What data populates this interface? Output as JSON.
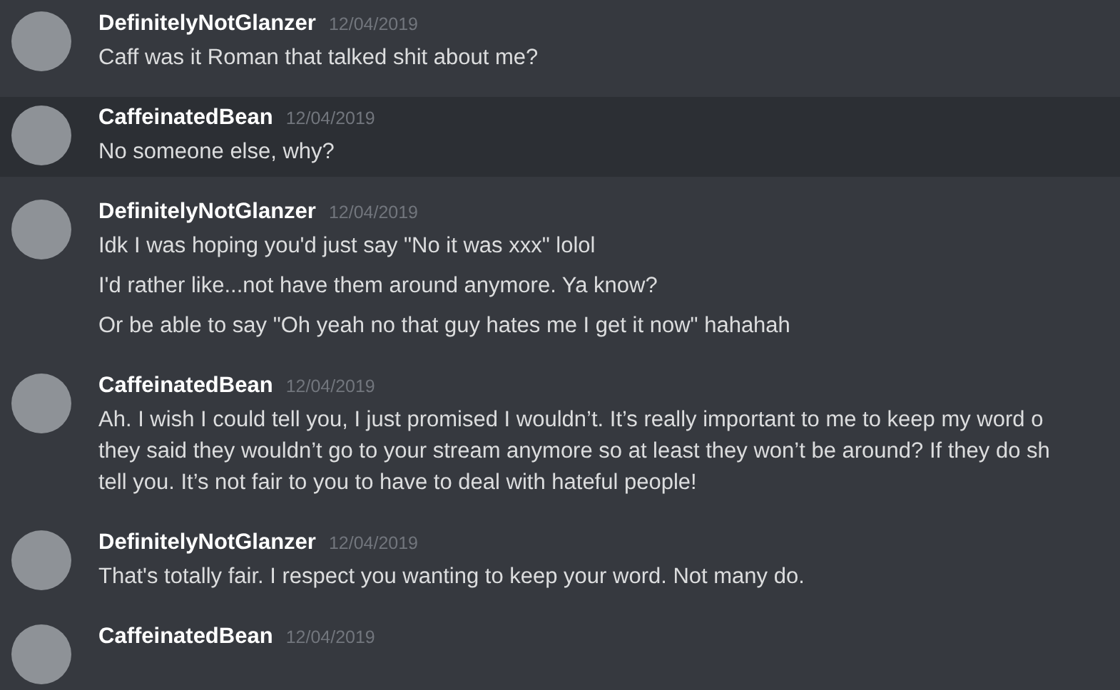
{
  "groups": [
    {
      "author": "DefinitelyNotGlanzer",
      "timestamp": "12/04/2019",
      "messages": [
        {
          "lines": [
            "Caff was it Roman that talked shit about me?"
          ]
        }
      ]
    },
    {
      "author": "CaffeinatedBean",
      "timestamp": "12/04/2019",
      "highlighted": true,
      "messages": [
        {
          "lines": [
            "No someone else, why?"
          ]
        }
      ]
    },
    {
      "author": "DefinitelyNotGlanzer",
      "timestamp": "12/04/2019",
      "messages": [
        {
          "lines": [
            "Idk I was hoping you'd just say \"No it was xxx\" lolol"
          ]
        },
        {
          "lines": [
            "I'd rather like...not have them around anymore. Ya know?"
          ]
        },
        {
          "lines": [
            "Or be able to say \"Oh yeah no that guy hates me I get it now\" hahahah"
          ]
        }
      ]
    },
    {
      "author": "CaffeinatedBean",
      "timestamp": "12/04/2019",
      "messages": [
        {
          "lines": [
            "Ah. I wish I could tell you, I just promised I wouldn’t. It’s really important to me to keep my word o",
            "they said they wouldn’t go to your stream anymore so at least they won’t be around? If they do sh",
            "tell you. It’s not fair to you to have to deal with hateful people!"
          ]
        }
      ]
    },
    {
      "author": "DefinitelyNotGlanzer",
      "timestamp": "12/04/2019",
      "messages": [
        {
          "lines": [
            "That's totally fair. I respect you wanting to keep your word. Not many do."
          ]
        }
      ]
    },
    {
      "author": "CaffeinatedBean",
      "timestamp": "12/04/2019"
    }
  ]
}
